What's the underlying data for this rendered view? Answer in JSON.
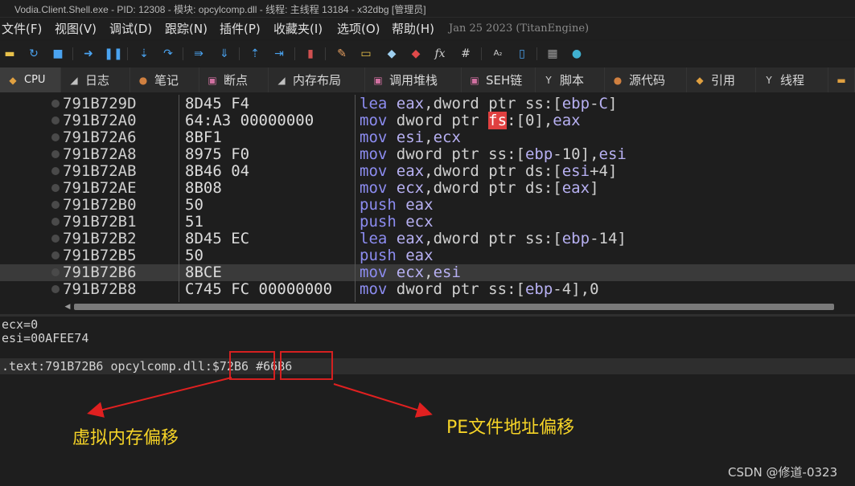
{
  "window": {
    "title": "Vodia.Client.Shell.exe - PID: 12308 - 模块: opcylcomp.dll - 线程: 主线程 13184 - x32dbg [管理员]"
  },
  "menu": {
    "items": [
      "文件(F)",
      "视图(V)",
      "调试(D)",
      "跟踪(N)",
      "插件(P)",
      "收藏夹(I)",
      "选项(O)",
      "帮助(H)"
    ],
    "build": "Jan 25 2023 (TitanEngine)"
  },
  "toolbar": {
    "icons": [
      "open-icon",
      "restart-icon",
      "stop-icon",
      "run-icon",
      "pause-icon",
      "step-into-icon",
      "step-over-icon",
      "trace-into-icon",
      "trace-over-icon",
      "run-to-user-icon",
      "run-to-selection-icon",
      "patch-icon",
      "comment-icon",
      "label-icon",
      "bookmark-icon",
      "function-icon",
      "hash-icon",
      "font-icon",
      "memory-icon",
      "calculator-icon",
      "globe-icon"
    ],
    "fx_glyph": "fx",
    "hash_glyph": "#",
    "font_glyph": "A₂"
  },
  "tabs": [
    {
      "label": "CPU",
      "active": true
    },
    {
      "label": "日志"
    },
    {
      "label": "笔记"
    },
    {
      "label": "断点"
    },
    {
      "label": "内存布局"
    },
    {
      "label": "调用堆栈"
    },
    {
      "label": "SEH链"
    },
    {
      "label": "脚本"
    },
    {
      "label": "源代码"
    },
    {
      "label": "引用"
    },
    {
      "label": "线程"
    }
  ],
  "disassembly": [
    {
      "addr": "791B729D",
      "bytes": "8D45 F4",
      "instr": [
        [
          "m",
          "lea"
        ],
        [
          "p",
          " "
        ],
        [
          "r",
          "eax"
        ],
        [
          "p",
          ","
        ],
        [
          "n",
          "dword ptr "
        ],
        [
          "seg",
          "ss"
        ],
        [
          "p",
          ":["
        ],
        [
          "r",
          "ebp"
        ],
        [
          "p",
          "-"
        ],
        [
          "r",
          "C"
        ],
        [
          "p",
          "]"
        ]
      ]
    },
    {
      "addr": "791B72A0",
      "bytes": "64:A3 00000000",
      "instr": [
        [
          "m",
          "mov"
        ],
        [
          "p",
          " "
        ],
        [
          "n",
          "dword ptr "
        ],
        [
          "fs",
          "fs"
        ],
        [
          "p",
          ":["
        ],
        [
          "n",
          "0"
        ],
        [
          "p",
          "],"
        ],
        [
          "r",
          "eax"
        ]
      ]
    },
    {
      "addr": "791B72A6",
      "bytes": "8BF1",
      "instr": [
        [
          "m",
          "mov"
        ],
        [
          "p",
          " "
        ],
        [
          "r",
          "esi"
        ],
        [
          "p",
          ","
        ],
        [
          "r",
          "ecx"
        ]
      ]
    },
    {
      "addr": "791B72A8",
      "bytes": "8975 F0",
      "instr": [
        [
          "m",
          "mov"
        ],
        [
          "p",
          " "
        ],
        [
          "n",
          "dword ptr "
        ],
        [
          "seg",
          "ss"
        ],
        [
          "p",
          ":["
        ],
        [
          "r",
          "ebp"
        ],
        [
          "p",
          "-"
        ],
        [
          "n",
          "10"
        ],
        [
          "p",
          "],"
        ],
        [
          "r",
          "esi"
        ]
      ]
    },
    {
      "addr": "791B72AB",
      "bytes": "8B46 04",
      "instr": [
        [
          "m",
          "mov"
        ],
        [
          "p",
          " "
        ],
        [
          "r",
          "eax"
        ],
        [
          "p",
          ","
        ],
        [
          "n",
          "dword ptr "
        ],
        [
          "seg",
          "ds"
        ],
        [
          "p",
          ":["
        ],
        [
          "r",
          "esi"
        ],
        [
          "p",
          "+"
        ],
        [
          "n",
          "4"
        ],
        [
          "p",
          "]"
        ]
      ]
    },
    {
      "addr": "791B72AE",
      "bytes": "8B08",
      "instr": [
        [
          "m",
          "mov"
        ],
        [
          "p",
          " "
        ],
        [
          "r",
          "ecx"
        ],
        [
          "p",
          ","
        ],
        [
          "n",
          "dword ptr "
        ],
        [
          "seg",
          "ds"
        ],
        [
          "p",
          ":["
        ],
        [
          "r",
          "eax"
        ],
        [
          "p",
          "]"
        ]
      ]
    },
    {
      "addr": "791B72B0",
      "bytes": "50",
      "instr": [
        [
          "m",
          "push"
        ],
        [
          "p",
          " "
        ],
        [
          "r",
          "eax"
        ]
      ]
    },
    {
      "addr": "791B72B1",
      "bytes": "51",
      "instr": [
        [
          "m",
          "push"
        ],
        [
          "p",
          " "
        ],
        [
          "r",
          "ecx"
        ]
      ]
    },
    {
      "addr": "791B72B2",
      "bytes": "8D45 EC",
      "instr": [
        [
          "m",
          "lea"
        ],
        [
          "p",
          " "
        ],
        [
          "r",
          "eax"
        ],
        [
          "p",
          ","
        ],
        [
          "n",
          "dword ptr "
        ],
        [
          "seg",
          "ss"
        ],
        [
          "p",
          ":["
        ],
        [
          "r",
          "ebp"
        ],
        [
          "p",
          "-"
        ],
        [
          "n",
          "14"
        ],
        [
          "p",
          "]"
        ]
      ]
    },
    {
      "addr": "791B72B5",
      "bytes": "50",
      "instr": [
        [
          "m",
          "push"
        ],
        [
          "p",
          " "
        ],
        [
          "r",
          "eax"
        ]
      ]
    },
    {
      "addr": "791B72B6",
      "bytes": "8BCE",
      "instr": [
        [
          "m",
          "mov"
        ],
        [
          "p",
          " "
        ],
        [
          "r",
          "ecx"
        ],
        [
          "p",
          ","
        ],
        [
          "r",
          "esi"
        ]
      ],
      "highlight": true
    },
    {
      "addr": "791B72B8",
      "bytes": "C745 FC 00000000",
      "instr": [
        [
          "m",
          "mov"
        ],
        [
          "p",
          " "
        ],
        [
          "n",
          "dword ptr "
        ],
        [
          "seg",
          "ss"
        ],
        [
          "p",
          ":["
        ],
        [
          "r",
          "ebp"
        ],
        [
          "p",
          "-"
        ],
        [
          "n",
          "4"
        ],
        [
          "p",
          "],"
        ],
        [
          "n",
          "0"
        ]
      ]
    }
  ],
  "info": {
    "line1": "ecx=0",
    "line2": "esi=00AFEE74",
    "location_prefix": ".text:791B72B6 opcylcomp.dll:",
    "rva": "$72B6",
    "file_offset": "#66B6"
  },
  "annotations": {
    "rva_label": "虚拟内存偏移",
    "offset_label": "PE文件地址偏移",
    "arrow_color": "#e02020",
    "label_color": "#f5d327"
  },
  "watermark": "CSDN @修道-0323"
}
